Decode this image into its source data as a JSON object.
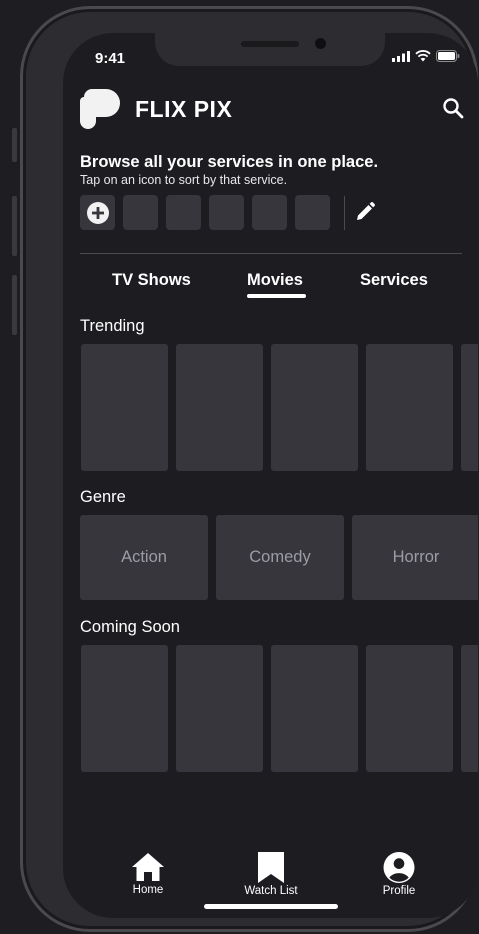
{
  "status": {
    "time": "9:41"
  },
  "app": {
    "title": "FLIX PIX"
  },
  "services": {
    "headline": "Browse all your services in one place.",
    "subtitle": "Tap on an icon to sort by that  service."
  },
  "tabs": [
    {
      "label": "TV Shows"
    },
    {
      "label": "Movies"
    },
    {
      "label": "Services"
    }
  ],
  "active_tab": "Movies",
  "sections": {
    "trending": "Trending",
    "genre": "Genre",
    "coming_soon": "Coming Soon"
  },
  "genres": [
    "Action",
    "Comedy",
    "Horror"
  ],
  "nav": [
    {
      "label": "Home",
      "icon": "home-icon"
    },
    {
      "label": "Watch List",
      "icon": "bookmark-icon"
    },
    {
      "label": "Profile",
      "icon": "profile-icon"
    }
  ],
  "colors": {
    "background": "#1d1c21",
    "card": "#36363c",
    "text": "#ffffff",
    "muted": "#9c9ca4"
  }
}
